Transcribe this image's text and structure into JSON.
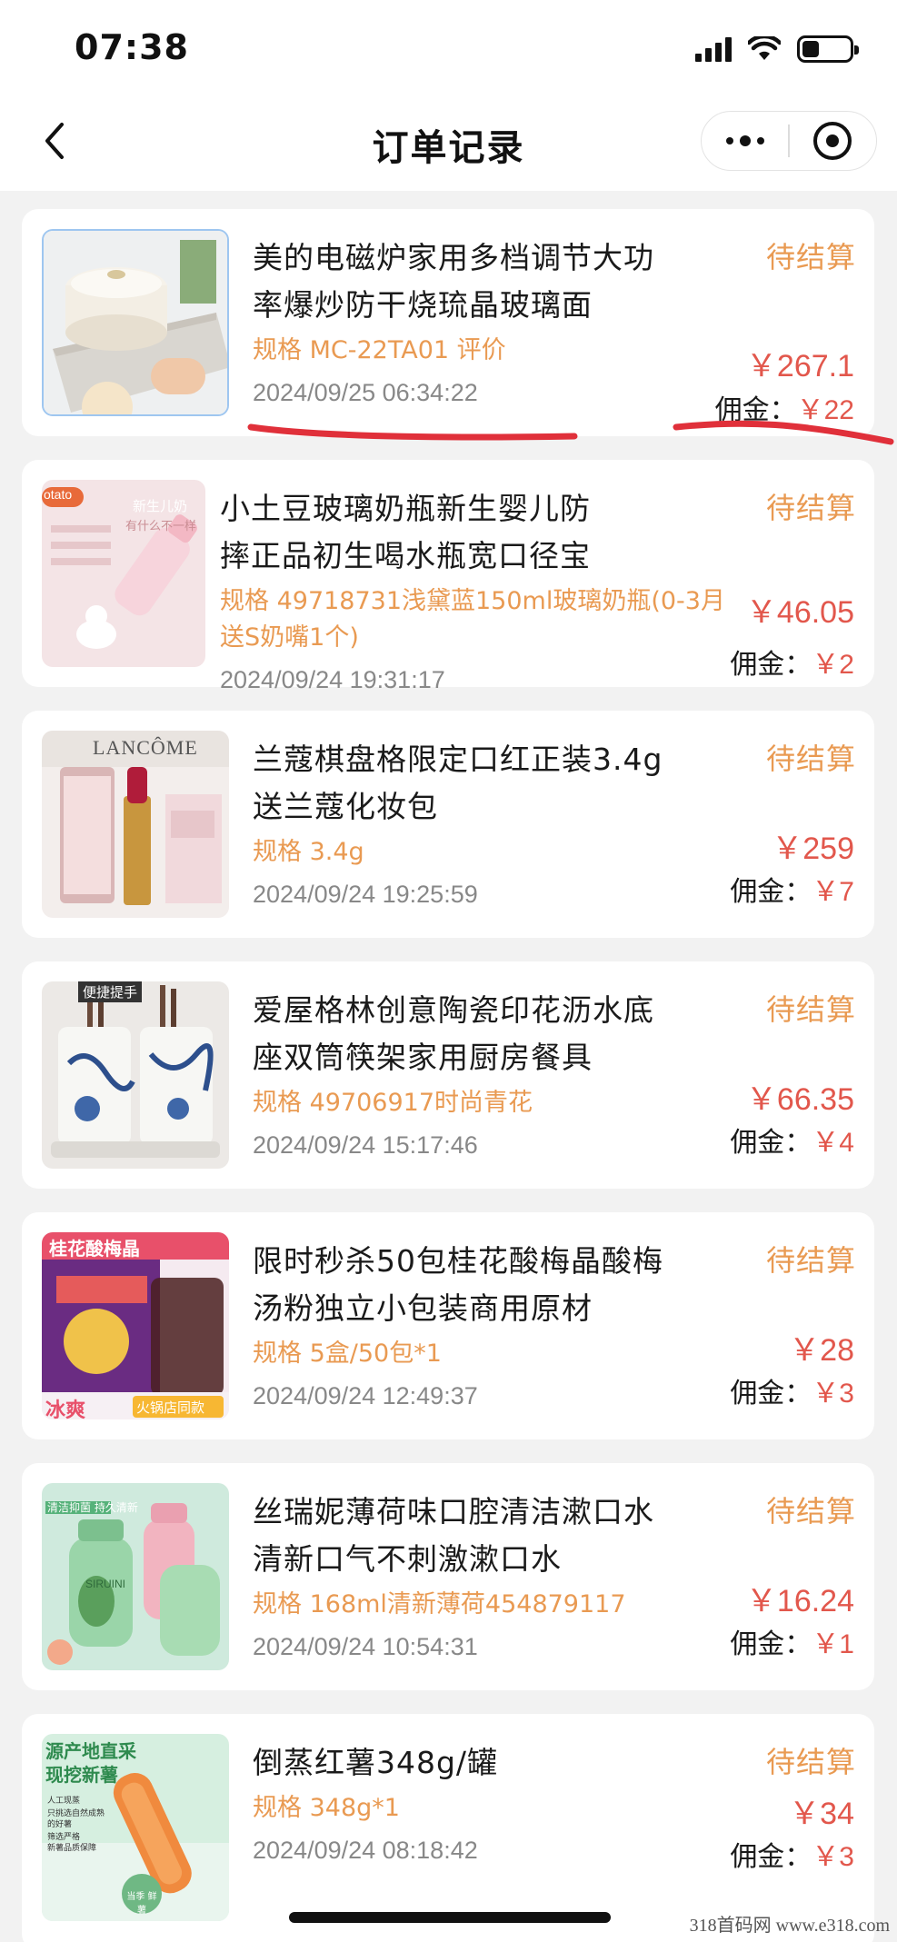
{
  "status_bar": {
    "time": "07:38"
  },
  "nav": {
    "title": "订单记录"
  },
  "labels": {
    "commission": "佣金："
  },
  "orders": [
    {
      "title": "美的电磁炉家用多档调节大功率爆炒防干烧琉晶玻璃面",
      "spec": "规格 MC-22TA01 评价",
      "date": "2024/09/25 06:34:22",
      "status": "待结算",
      "price": "￥267.1",
      "commission": "￥22"
    },
    {
      "title": "小土豆玻璃奶瓶新生婴儿防摔正品初生喝水瓶宽口径宝",
      "spec": "规格 49718731浅黛蓝150ml玻璃奶瓶(0-3月送S奶嘴1个)",
      "date": "2024/09/24 19:31:17",
      "status": "待结算",
      "price": "￥46.05",
      "commission": "￥2",
      "thumb_text": [
        "otato",
        "新生儿奶",
        "有什么不一样"
      ]
    },
    {
      "title": "兰蔻棋盘格限定口红正装3.4g 送兰蔻化妆包",
      "spec": "规格 3.4g",
      "date": "2024/09/24 19:25:59",
      "status": "待结算",
      "price": "￥259",
      "commission": "￥7",
      "thumb_text": [
        "LANCÔME"
      ]
    },
    {
      "title": "爱屋格林创意陶瓷印花沥水底座双筒筷架家用厨房餐具",
      "spec": "规格 49706917时尚青花",
      "date": "2024/09/24 15:17:46",
      "status": "待结算",
      "price": "￥66.35",
      "commission": "￥4",
      "thumb_text": [
        "便捷提手"
      ]
    },
    {
      "title": "限时秒杀50包桂花酸梅晶酸梅汤粉独立小包装商用原材",
      "spec": "规格 5盒/50包*1",
      "date": "2024/09/24 12:49:37",
      "status": "待结算",
      "price": "￥28",
      "commission": "￥3",
      "thumb_text": [
        "桂花酸梅晶",
        "冰爽",
        "火锅店同款"
      ]
    },
    {
      "title": "丝瑞妮薄荷味口腔清洁漱口水 清新口气不刺激漱口水",
      "spec": "规格 168ml清新薄荷454879117",
      "date": "2024/09/24 10:54:31",
      "status": "待结算",
      "price": "￥16.24",
      "commission": "￥1",
      "thumb_text": [
        "清洁抑菌 持久清新",
        "SIRUINI"
      ]
    },
    {
      "title": "倒蒸红薯348g/罐",
      "spec": "规格 348g*1",
      "date": "2024/09/24 08:18:42",
      "status": "待结算",
      "price": "￥34",
      "commission": "￥3",
      "thumb_text": [
        "源产地直采",
        "现挖新薯",
        "人工现蒸",
        "只挑选自然成熟的好薯",
        "筛选严格",
        "新薯品质保障",
        "当季 鲜薯"
      ]
    }
  ],
  "watermark": "318首码网 www.e318.com",
  "colors": {
    "accent_orange": "#e99a52",
    "price_red": "#e2574c",
    "underline_red": "#e0303a"
  }
}
